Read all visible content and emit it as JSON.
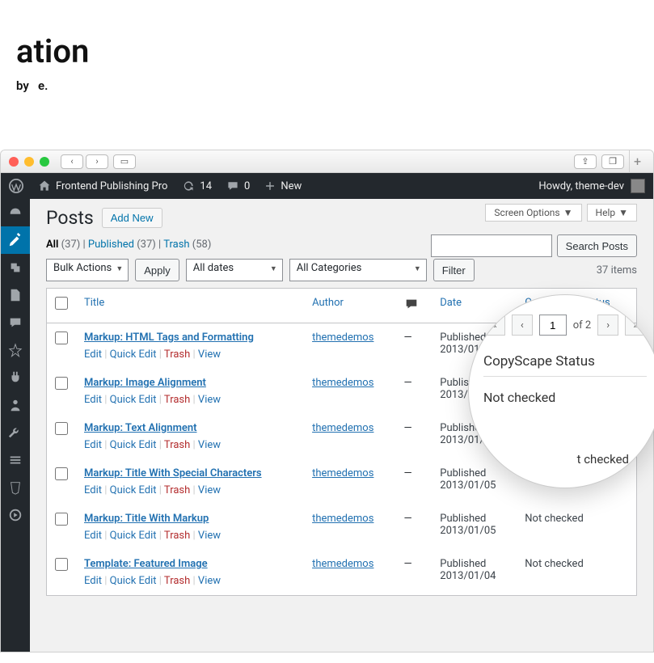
{
  "hero": {
    "title_suffix": "ation",
    "subtitle_mid": "by",
    "subtitle_end": "e."
  },
  "adminbar": {
    "site_name": "Frontend Publishing Pro",
    "updates": "14",
    "comments": "0",
    "new_label": "New",
    "howdy": "Howdy, theme-dev"
  },
  "top_right": {
    "screen_options": "Screen Options",
    "help": "Help"
  },
  "page": {
    "heading": "Posts",
    "add_new": "Add New"
  },
  "filters": {
    "all_label": "All",
    "all_count": "(37)",
    "published_label": "Published",
    "published_count": "(37)",
    "trash_label": "Trash",
    "trash_count": "(58)"
  },
  "bulk": {
    "bulk_actions": "Bulk Actions",
    "apply": "Apply",
    "all_dates": "All dates",
    "all_categories": "All Categories",
    "filter": "Filter"
  },
  "search": {
    "button": "Search Posts",
    "placeholder": ""
  },
  "pagination": {
    "items": "37 items"
  },
  "columns": {
    "title": "Title",
    "author": "Author",
    "date": "Date",
    "copyscape": "CopyScape Status"
  },
  "row_actions": {
    "edit": "Edit",
    "quick_edit": "Quick Edit",
    "trash": "Trash",
    "view": "View"
  },
  "rows": [
    {
      "title": "Markup: HTML Tags and Formatting",
      "author": "themedemos",
      "date_status": "Published",
      "date": "2013/01/11",
      "cs": "Not checked"
    },
    {
      "title": "Markup: Image Alignment",
      "author": "themedemos",
      "date_status": "Published",
      "date": "2013/01/10",
      "cs": "Not checked"
    },
    {
      "title": "Markup: Text Alignment",
      "author": "themedemos",
      "date_status": "Published",
      "date": "2013/01/09",
      "cs": "Not checked"
    },
    {
      "title": "Markup: Title With Special Characters",
      "author": "themedemos",
      "date_status": "Published",
      "date": "2013/01/05",
      "cs": "Not checked"
    },
    {
      "title": "Markup: Title With Markup",
      "author": "themedemos",
      "date_status": "Published",
      "date": "2013/01/05",
      "cs": "Not checked"
    },
    {
      "title": "Template: Featured Image",
      "author": "themedemos",
      "date_status": "Published",
      "date": "2013/01/04",
      "cs": "Not checked"
    }
  ],
  "magnifier": {
    "page": "1",
    "of": "of 2",
    "header": "CopyScape Status",
    "status": "Not checked",
    "partial": "t checked"
  }
}
